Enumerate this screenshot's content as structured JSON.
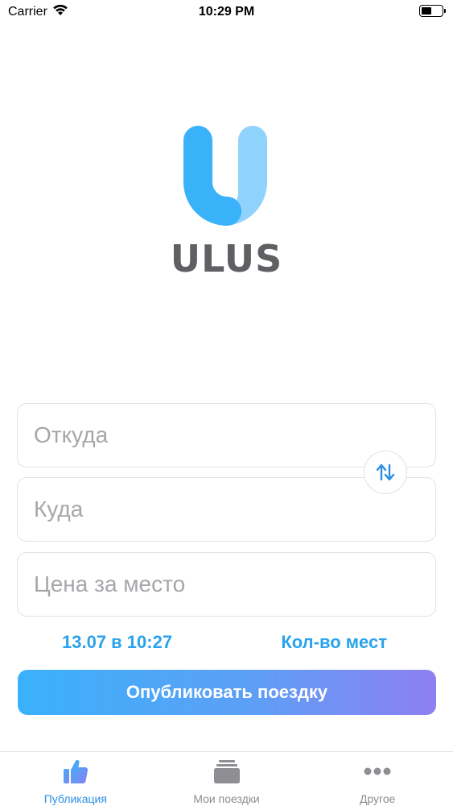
{
  "status_bar": {
    "carrier": "Carrier",
    "time": "10:29 PM",
    "battery_level": 0.5
  },
  "logo": {
    "wordmark": "ULUS",
    "icon": "ulus-u-logo-icon",
    "colors": {
      "primary": "#3ab2f9",
      "secondary": "#8fd3fd",
      "text": "#5f6063"
    }
  },
  "form": {
    "from_placeholder": "Откуда",
    "to_placeholder": "Куда",
    "price_placeholder": "Цена за место",
    "swap_icon": "swap-arrows-icon",
    "date_time": "13.07 в 10:27",
    "seats_label": "Кол-во мест",
    "publish_label": "Опубликовать поездку"
  },
  "tabs": [
    {
      "label": "Публикация",
      "icon": "thumbs-up-icon",
      "active": true
    },
    {
      "label": "Мои поездки",
      "icon": "stack-icon",
      "active": false
    },
    {
      "label": "Другое",
      "icon": "more-dots-icon",
      "active": false
    }
  ],
  "colors": {
    "accent": "#2aa3ec",
    "tab_active": "#2c8fe6",
    "tab_inactive": "#8e8e93",
    "button_gradient_start": "#3ab1fb",
    "button_gradient_end": "#8d80f2"
  }
}
